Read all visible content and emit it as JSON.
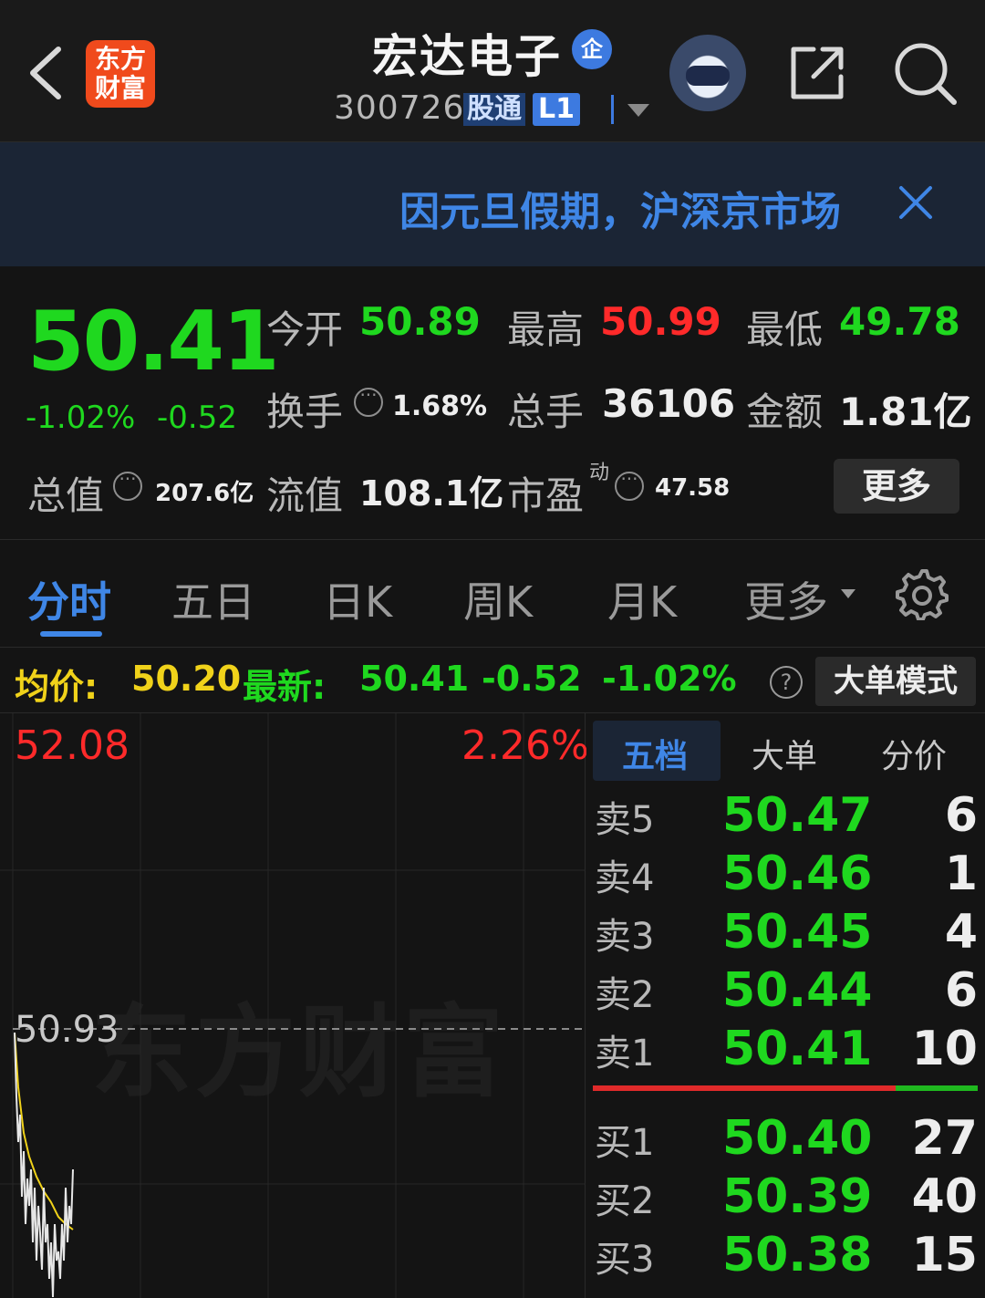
{
  "header": {
    "back_icon": "chevron-left-icon",
    "logo_line1": "东方",
    "logo_line2": "财富",
    "title": "宏达电子",
    "title_badge": "企",
    "code": "300726",
    "tag_connect": "股通",
    "tag_level": "L1",
    "share_icon": "share-icon",
    "search_icon": "search-icon"
  },
  "notice": {
    "text": "因元旦假期，沪深京市场",
    "close_icon": "close-icon"
  },
  "quote": {
    "price": "50.41",
    "change_pct": "-1.02%",
    "change_abs": "-0.52",
    "open_label": "今开",
    "open_value": "50.89",
    "high_label": "最高",
    "high_value": "50.99",
    "low_label": "最低",
    "low_value": "49.78",
    "turnover_label": "换手",
    "turnover_value": "1.68%",
    "volume_label": "总手",
    "volume_value": "36106",
    "amount_label": "金额",
    "amount_value": "1.81亿",
    "mktcap_label": "总值",
    "mktcap_value": "207.6亿",
    "float_label": "流值",
    "float_value": "108.1亿",
    "pe_label": "市盈",
    "pe_sup": "动",
    "pe_value": "47.58",
    "more_button": "更多"
  },
  "tabs": {
    "items": [
      "分时",
      "五日",
      "日K",
      "周K",
      "月K",
      "更多"
    ],
    "active": "分时"
  },
  "inforow": {
    "avg_label": "均价:",
    "avg_value": "50.20",
    "latest_label": "最新:",
    "latest_value": "50.41",
    "chg_abs": "-0.52",
    "chg_pct": "-1.02%",
    "mode_button": "大单模式"
  },
  "chart": {
    "top_price": "52.08",
    "top_pct": "2.26%",
    "ref_price": "50.93",
    "watermark": "东方财富",
    "colors": {
      "price_line": "#e6e6e6",
      "avg_line": "#f0d21a"
    }
  },
  "book": {
    "tabs": [
      "五档",
      "大单",
      "分价"
    ],
    "active_tab": "五档",
    "asks": [
      {
        "label": "卖5",
        "price": "50.47",
        "qty": "6"
      },
      {
        "label": "卖4",
        "price": "50.46",
        "qty": "1"
      },
      {
        "label": "卖3",
        "price": "50.45",
        "qty": "4"
      },
      {
        "label": "卖2",
        "price": "50.44",
        "qty": "6"
      },
      {
        "label": "卖1",
        "price": "50.41",
        "qty": "10"
      }
    ],
    "bids": [
      {
        "label": "买1",
        "price": "50.40",
        "qty": "27"
      },
      {
        "label": "买2",
        "price": "50.39",
        "qty": "40"
      },
      {
        "label": "买3",
        "price": "50.38",
        "qty": "15"
      }
    ]
  },
  "colors": {
    "up": "#ff2a2a",
    "down": "#1fd81f",
    "accent": "#3f86e6",
    "avg": "#f0d21a"
  }
}
